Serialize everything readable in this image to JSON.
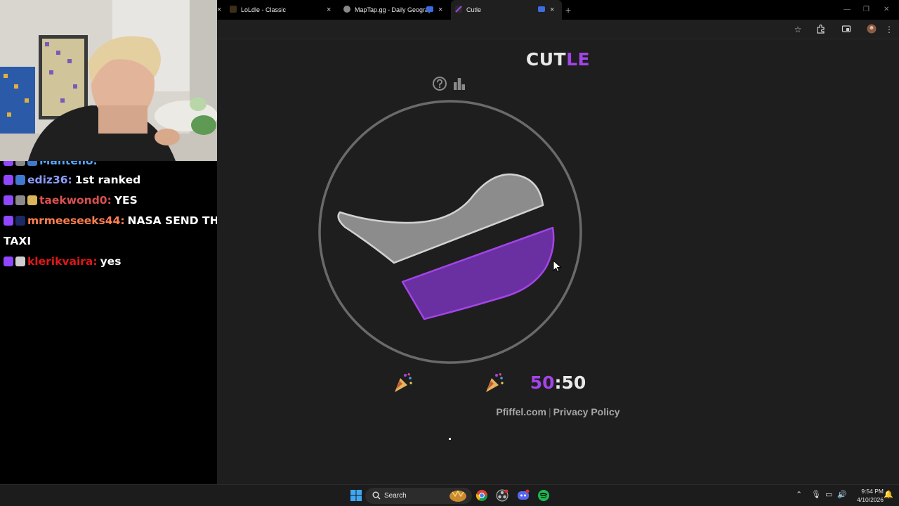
{
  "chat": {
    "messages": [
      {
        "user": "Manteno:",
        "text": "",
        "color": "#58a6ff"
      },
      {
        "user": "ediz36:",
        "text": "1st ranked",
        "color": "#8c9dff"
      },
      {
        "user": "taekwond0:",
        "text": "YES",
        "color": "#d95050"
      },
      {
        "user": "mrmeeseeks44:",
        "text": "NASA SEND THE",
        "color": "#ff7f50"
      },
      {
        "user": "",
        "text": "TAXI",
        "color": "#ffffff"
      },
      {
        "user": "klerikvaira:",
        "text": "yes",
        "color": "#e01818"
      }
    ]
  },
  "browser": {
    "tabs": [
      {
        "title": "LoLdle - Classic"
      },
      {
        "title": "MapTap.gg - Daily Geograp"
      },
      {
        "title": "Cutle"
      }
    ],
    "close_glyph": "×",
    "new_tab_glyph": "+"
  },
  "game": {
    "logo_part1": "CUT",
    "logo_part2": "LE",
    "score_left": "50",
    "score_sep": ":",
    "score_right": "50",
    "accent_color": "#a245e6"
  },
  "footer": {
    "link1": "Pfiffel.com",
    "separator": "|",
    "link2": "Privacy Policy"
  },
  "taskbar": {
    "search_label": "Search",
    "time": "9:54 PM",
    "date": "4/10/2026"
  }
}
